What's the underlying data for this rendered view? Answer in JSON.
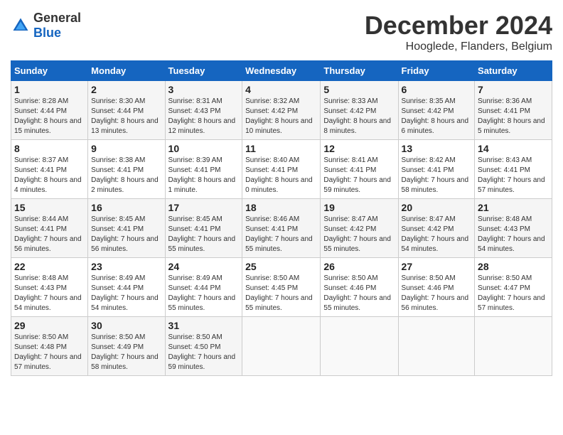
{
  "header": {
    "logo": {
      "text_general": "General",
      "text_blue": "Blue"
    },
    "title": "December 2024",
    "subtitle": "Hooglede, Flanders, Belgium"
  },
  "calendar": {
    "weekdays": [
      "Sunday",
      "Monday",
      "Tuesday",
      "Wednesday",
      "Thursday",
      "Friday",
      "Saturday"
    ],
    "weeks": [
      [
        {
          "day": "1",
          "sunrise": "Sunrise: 8:28 AM",
          "sunset": "Sunset: 4:44 PM",
          "daylight": "Daylight: 8 hours and 15 minutes."
        },
        {
          "day": "2",
          "sunrise": "Sunrise: 8:30 AM",
          "sunset": "Sunset: 4:44 PM",
          "daylight": "Daylight: 8 hours and 13 minutes."
        },
        {
          "day": "3",
          "sunrise": "Sunrise: 8:31 AM",
          "sunset": "Sunset: 4:43 PM",
          "daylight": "Daylight: 8 hours and 12 minutes."
        },
        {
          "day": "4",
          "sunrise": "Sunrise: 8:32 AM",
          "sunset": "Sunset: 4:42 PM",
          "daylight": "Daylight: 8 hours and 10 minutes."
        },
        {
          "day": "5",
          "sunrise": "Sunrise: 8:33 AM",
          "sunset": "Sunset: 4:42 PM",
          "daylight": "Daylight: 8 hours and 8 minutes."
        },
        {
          "day": "6",
          "sunrise": "Sunrise: 8:35 AM",
          "sunset": "Sunset: 4:42 PM",
          "daylight": "Daylight: 8 hours and 6 minutes."
        },
        {
          "day": "7",
          "sunrise": "Sunrise: 8:36 AM",
          "sunset": "Sunset: 4:41 PM",
          "daylight": "Daylight: 8 hours and 5 minutes."
        }
      ],
      [
        {
          "day": "8",
          "sunrise": "Sunrise: 8:37 AM",
          "sunset": "Sunset: 4:41 PM",
          "daylight": "Daylight: 8 hours and 4 minutes."
        },
        {
          "day": "9",
          "sunrise": "Sunrise: 8:38 AM",
          "sunset": "Sunset: 4:41 PM",
          "daylight": "Daylight: 8 hours and 2 minutes."
        },
        {
          "day": "10",
          "sunrise": "Sunrise: 8:39 AM",
          "sunset": "Sunset: 4:41 PM",
          "daylight": "Daylight: 8 hours and 1 minute."
        },
        {
          "day": "11",
          "sunrise": "Sunrise: 8:40 AM",
          "sunset": "Sunset: 4:41 PM",
          "daylight": "Daylight: 8 hours and 0 minutes."
        },
        {
          "day": "12",
          "sunrise": "Sunrise: 8:41 AM",
          "sunset": "Sunset: 4:41 PM",
          "daylight": "Daylight: 7 hours and 59 minutes."
        },
        {
          "day": "13",
          "sunrise": "Sunrise: 8:42 AM",
          "sunset": "Sunset: 4:41 PM",
          "daylight": "Daylight: 7 hours and 58 minutes."
        },
        {
          "day": "14",
          "sunrise": "Sunrise: 8:43 AM",
          "sunset": "Sunset: 4:41 PM",
          "daylight": "Daylight: 7 hours and 57 minutes."
        }
      ],
      [
        {
          "day": "15",
          "sunrise": "Sunrise: 8:44 AM",
          "sunset": "Sunset: 4:41 PM",
          "daylight": "Daylight: 7 hours and 56 minutes."
        },
        {
          "day": "16",
          "sunrise": "Sunrise: 8:45 AM",
          "sunset": "Sunset: 4:41 PM",
          "daylight": "Daylight: 7 hours and 56 minutes."
        },
        {
          "day": "17",
          "sunrise": "Sunrise: 8:45 AM",
          "sunset": "Sunset: 4:41 PM",
          "daylight": "Daylight: 7 hours and 55 minutes."
        },
        {
          "day": "18",
          "sunrise": "Sunrise: 8:46 AM",
          "sunset": "Sunset: 4:41 PM",
          "daylight": "Daylight: 7 hours and 55 minutes."
        },
        {
          "day": "19",
          "sunrise": "Sunrise: 8:47 AM",
          "sunset": "Sunset: 4:42 PM",
          "daylight": "Daylight: 7 hours and 55 minutes."
        },
        {
          "day": "20",
          "sunrise": "Sunrise: 8:47 AM",
          "sunset": "Sunset: 4:42 PM",
          "daylight": "Daylight: 7 hours and 54 minutes."
        },
        {
          "day": "21",
          "sunrise": "Sunrise: 8:48 AM",
          "sunset": "Sunset: 4:43 PM",
          "daylight": "Daylight: 7 hours and 54 minutes."
        }
      ],
      [
        {
          "day": "22",
          "sunrise": "Sunrise: 8:48 AM",
          "sunset": "Sunset: 4:43 PM",
          "daylight": "Daylight: 7 hours and 54 minutes."
        },
        {
          "day": "23",
          "sunrise": "Sunrise: 8:49 AM",
          "sunset": "Sunset: 4:44 PM",
          "daylight": "Daylight: 7 hours and 54 minutes."
        },
        {
          "day": "24",
          "sunrise": "Sunrise: 8:49 AM",
          "sunset": "Sunset: 4:44 PM",
          "daylight": "Daylight: 7 hours and 55 minutes."
        },
        {
          "day": "25",
          "sunrise": "Sunrise: 8:50 AM",
          "sunset": "Sunset: 4:45 PM",
          "daylight": "Daylight: 7 hours and 55 minutes."
        },
        {
          "day": "26",
          "sunrise": "Sunrise: 8:50 AM",
          "sunset": "Sunset: 4:46 PM",
          "daylight": "Daylight: 7 hours and 55 minutes."
        },
        {
          "day": "27",
          "sunrise": "Sunrise: 8:50 AM",
          "sunset": "Sunset: 4:46 PM",
          "daylight": "Daylight: 7 hours and 56 minutes."
        },
        {
          "day": "28",
          "sunrise": "Sunrise: 8:50 AM",
          "sunset": "Sunset: 4:47 PM",
          "daylight": "Daylight: 7 hours and 57 minutes."
        }
      ],
      [
        {
          "day": "29",
          "sunrise": "Sunrise: 8:50 AM",
          "sunset": "Sunset: 4:48 PM",
          "daylight": "Daylight: 7 hours and 57 minutes."
        },
        {
          "day": "30",
          "sunrise": "Sunrise: 8:50 AM",
          "sunset": "Sunset: 4:49 PM",
          "daylight": "Daylight: 7 hours and 58 minutes."
        },
        {
          "day": "31",
          "sunrise": "Sunrise: 8:50 AM",
          "sunset": "Sunset: 4:50 PM",
          "daylight": "Daylight: 7 hours and 59 minutes."
        },
        null,
        null,
        null,
        null
      ]
    ]
  }
}
